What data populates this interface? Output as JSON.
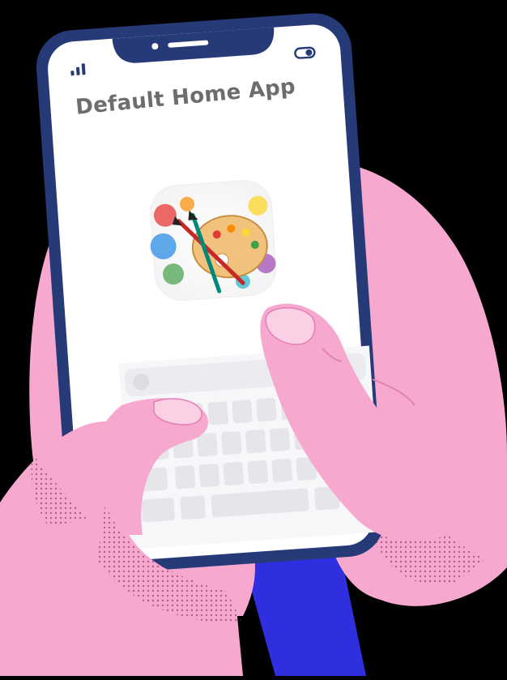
{
  "screen": {
    "title": "Default Home App",
    "app_icon": "paint-palette-icon"
  },
  "status_bar": {
    "signal_icon": "signal-bars-icon",
    "battery_icon": "battery-toggle-icon"
  },
  "keyboard": {
    "state": "partially-obscured",
    "search_icon": "magnifier-icon"
  },
  "colors": {
    "background": "#000000",
    "phone_frame": "#273a78",
    "screen": "#ffffff",
    "hand": "#f7a8cf",
    "hand_outline": "#e27fb4",
    "sleeve": "#2f2fe0",
    "title_text": "#6d6d6d",
    "key": "#e6e6ea"
  }
}
